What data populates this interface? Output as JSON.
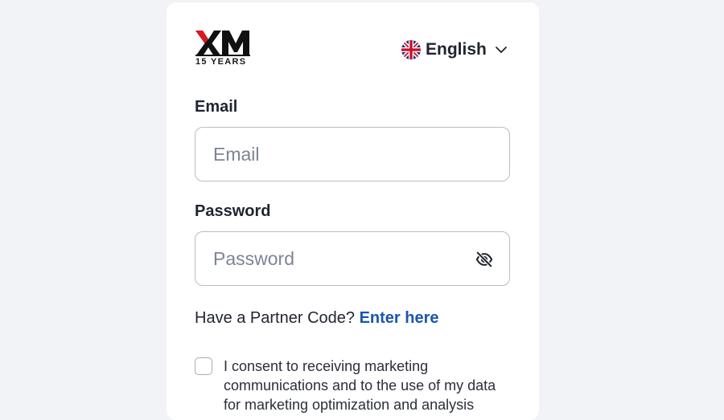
{
  "brand": {
    "logo_text": "XM",
    "tagline": "15 YEARS",
    "logo_color": "#d71920",
    "logo_dark": "#111111"
  },
  "language": {
    "selected": "English",
    "flag_icon": "uk-flag-icon",
    "dropdown_icon": "chevron-down-icon"
  },
  "form": {
    "email": {
      "label": "Email",
      "placeholder": "Email",
      "value": ""
    },
    "password": {
      "label": "Password",
      "placeholder": "Password",
      "value": "",
      "toggle_icon": "eye-off-icon"
    },
    "partner": {
      "question": "Have a Partner Code?",
      "link_label": "Enter here",
      "link_color": "#1b55b3"
    },
    "consent": {
      "checked": false,
      "text": "I consent to receiving marketing communications and to the use of my data for marketing optimization and analysis"
    }
  },
  "colors": {
    "background": "#f2f3f6",
    "card": "#ffffff",
    "input_border": "#b8bec8",
    "text": "#1f2430",
    "placeholder": "#7d8594"
  }
}
